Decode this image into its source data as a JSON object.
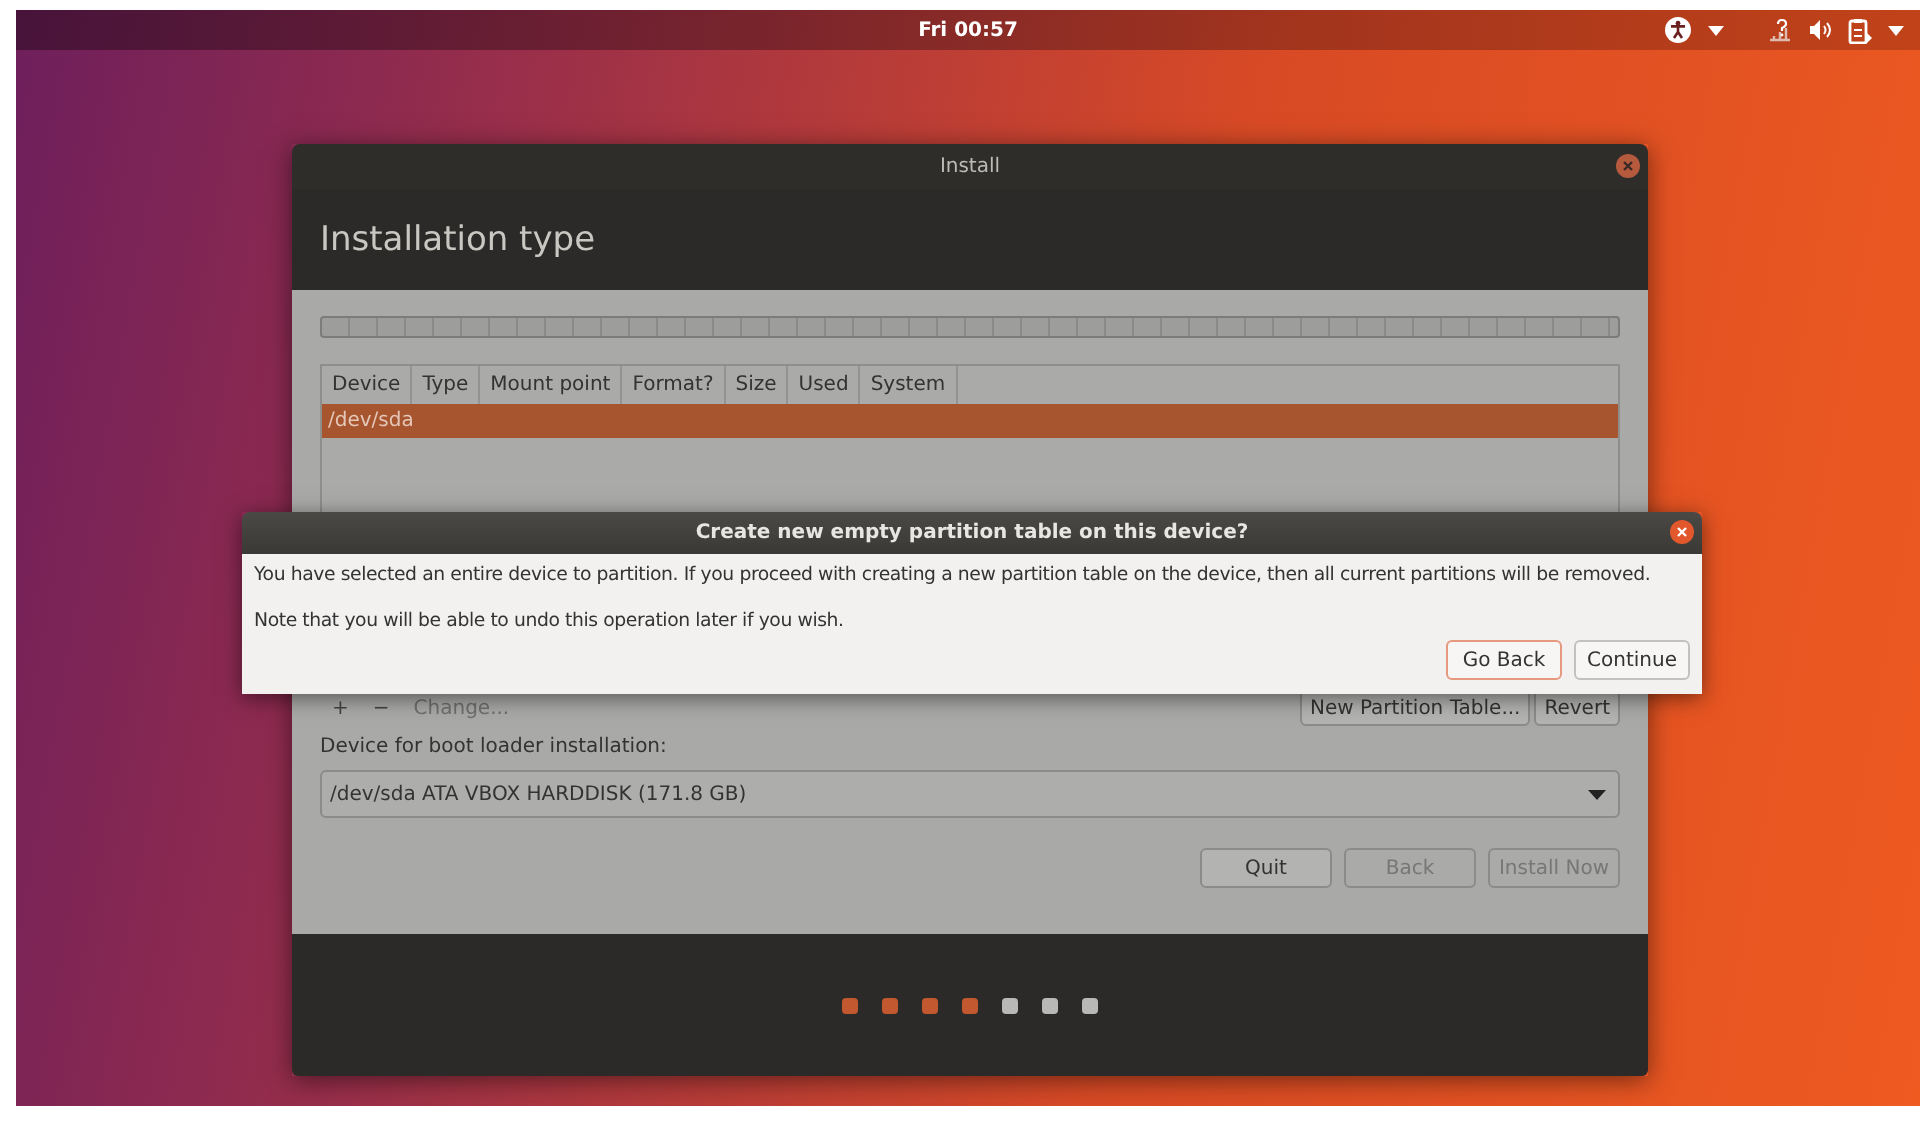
{
  "top_bar": {
    "clock": "Fri 00:57"
  },
  "window": {
    "title": "Install",
    "heading": "Installation type",
    "table": {
      "columns": [
        "Device",
        "Type",
        "Mount point",
        "Format?",
        "Size",
        "Used",
        "System"
      ],
      "rows": [
        {
          "device": "/dev/sda",
          "selected": true
        }
      ]
    },
    "actions": [
      {
        "label": "+",
        "disabled": false
      },
      {
        "label": "−",
        "disabled": false
      },
      {
        "label": "Change...",
        "disabled": true
      }
    ],
    "table_buttons": [
      "New Partition Table...",
      "Revert"
    ],
    "bootloader": {
      "label": "Device for boot loader installation:",
      "value": "/dev/sda ATA VBOX HARDDISK (171.8 GB)"
    },
    "buttons": [
      {
        "label": "Quit",
        "disabled": false
      },
      {
        "label": "Back",
        "disabled": true
      },
      {
        "label": "Install Now",
        "disabled": true
      }
    ],
    "steps": [
      {
        "done": true
      },
      {
        "done": true
      },
      {
        "done": true
      },
      {
        "done": true
      },
      {
        "done": false
      },
      {
        "done": false
      },
      {
        "done": false
      }
    ]
  },
  "dialog": {
    "title": "Create new empty partition table on this device?",
    "messages": [
      "You have selected an entire device to partition. If you proceed with creating a new partition table on the device, then all current partitions will be removed.",
      "Note that you will be able to undo this operation later if you wish."
    ],
    "buttons": [
      {
        "label": "Go Back",
        "selected": true
      },
      {
        "label": "Continue",
        "selected": false
      }
    ]
  }
}
